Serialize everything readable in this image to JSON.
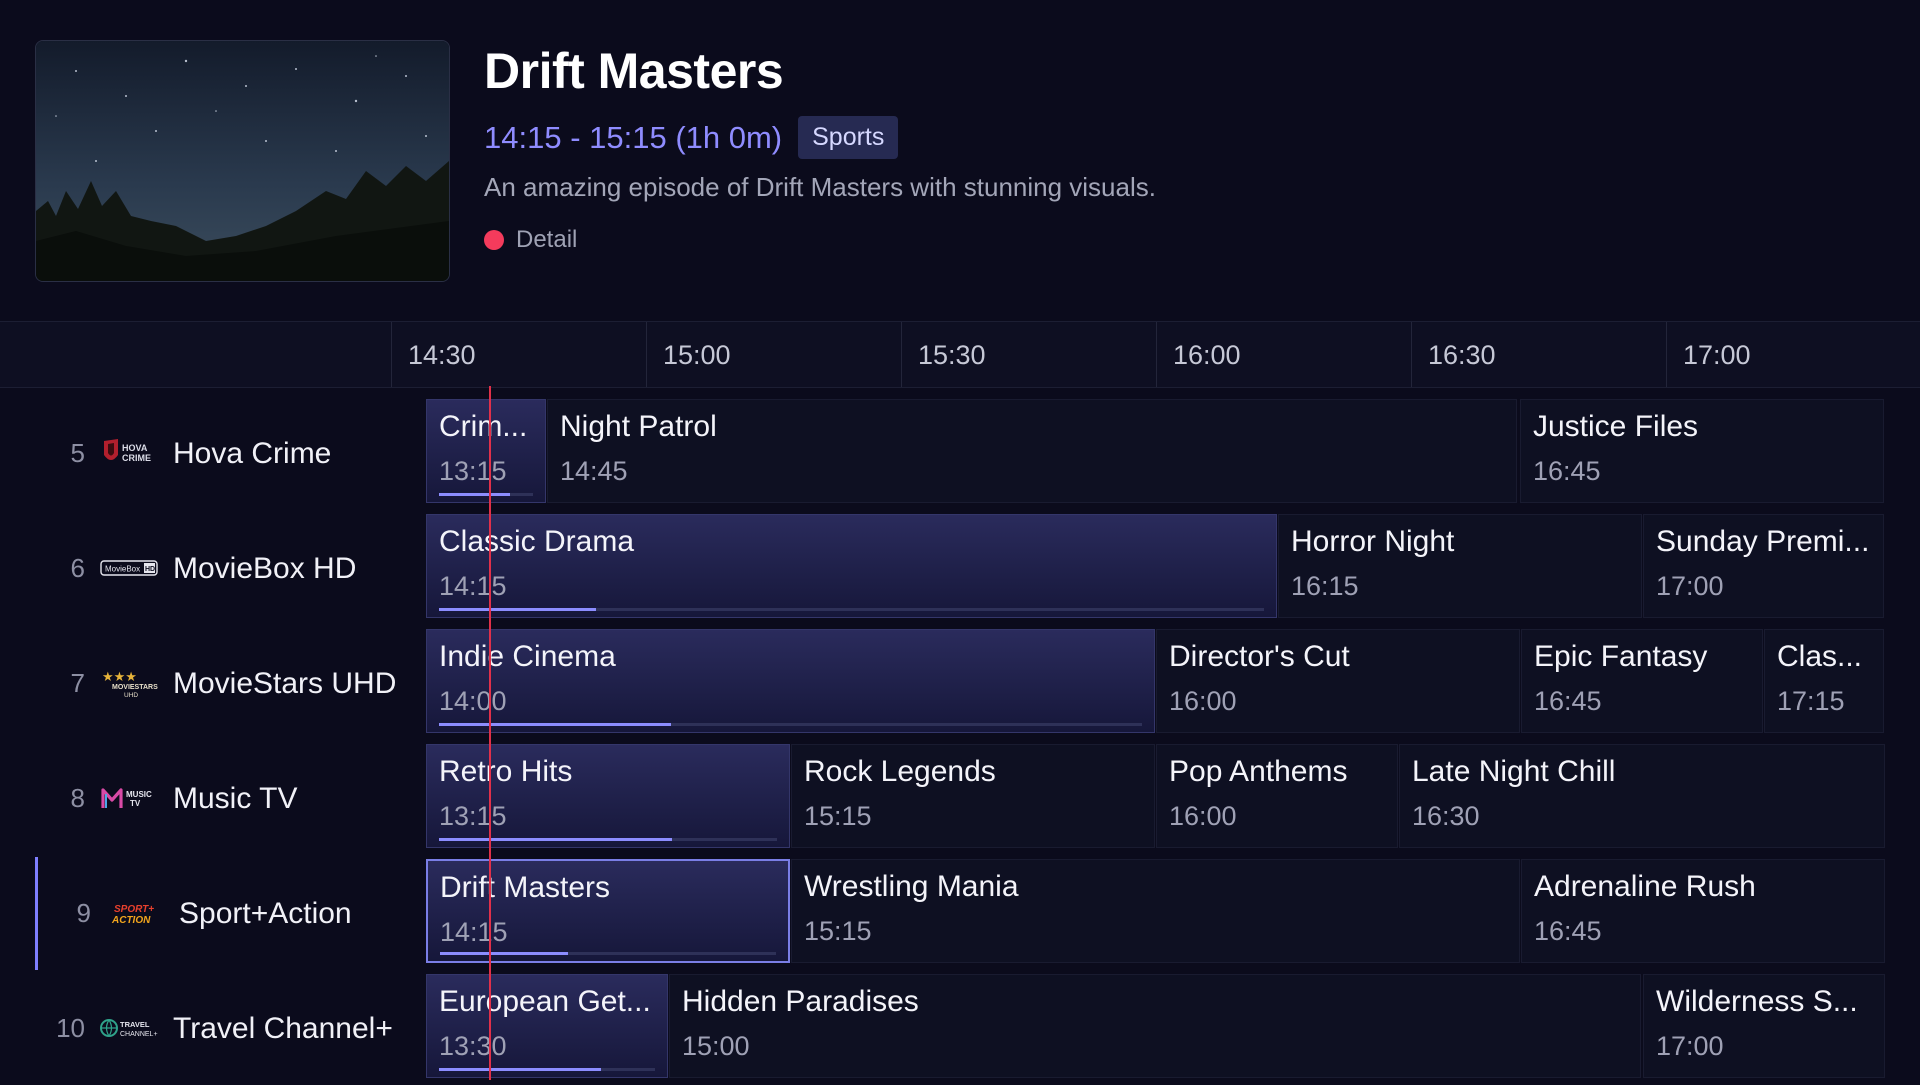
{
  "now_playing": {
    "title": "Drift Masters",
    "time_range": "14:15 - 15:15 (1h 0m)",
    "genre": "Sports",
    "description": "An amazing episode of Drift Masters with stunning visuals.",
    "detail_label": "Detail"
  },
  "timeline": {
    "slots": [
      "14:30",
      "15:00",
      "15:30",
      "16:00",
      "16:30",
      "17:00"
    ]
  },
  "colors": {
    "accent": "#8f8cff",
    "now_line": "#e0304a",
    "detail_dot": "#f43b5c",
    "background": "#0b0b1c"
  },
  "channels": [
    {
      "number": "5",
      "name": "Hova Crime",
      "logo": "hova-crime-logo",
      "programs": [
        {
          "title": "Crim...",
          "time": "13:15",
          "current": true,
          "progress": 0.75
        },
        {
          "title": "Night Patrol",
          "time": "14:45"
        },
        {
          "title": "Justice Files",
          "time": "16:45"
        }
      ]
    },
    {
      "number": "6",
      "name": "MovieBox HD",
      "logo": "moviebox-hd-logo",
      "programs": [
        {
          "title": "Classic Drama",
          "time": "14:15",
          "current": true,
          "progress": 0.19
        },
        {
          "title": "Horror Night",
          "time": "16:15"
        },
        {
          "title": "Sunday Premi...",
          "time": "17:00"
        }
      ]
    },
    {
      "number": "7",
      "name": "MovieStars UHD",
      "logo": "moviestars-uhd-logo",
      "programs": [
        {
          "title": "Indie Cinema",
          "time": "14:00",
          "current": true,
          "progress": 0.33
        },
        {
          "title": "Director's Cut",
          "time": "16:00"
        },
        {
          "title": "Epic Fantasy",
          "time": "16:45"
        },
        {
          "title": "Clas...",
          "time": "17:15"
        }
      ]
    },
    {
      "number": "8",
      "name": "Music TV",
      "logo": "music-tv-logo",
      "programs": [
        {
          "title": "Retro Hits",
          "time": "13:15",
          "current": true,
          "progress": 0.69
        },
        {
          "title": "Rock Legends",
          "time": "15:15"
        },
        {
          "title": "Pop Anthems",
          "time": "16:00"
        },
        {
          "title": "Late Night Chill",
          "time": "16:30"
        }
      ]
    },
    {
      "number": "9",
      "name": "Sport+Action",
      "logo": "sport-action-logo",
      "selected": true,
      "programs": [
        {
          "title": "Drift Masters",
          "time": "14:15",
          "current": true,
          "focused": true,
          "progress": 0.38
        },
        {
          "title": "Wrestling Mania",
          "time": "15:15"
        },
        {
          "title": "Adrenaline Rush",
          "time": "16:45"
        }
      ]
    },
    {
      "number": "10",
      "name": "Travel Channel+",
      "logo": "travel-channel-logo",
      "programs": [
        {
          "title": "European Get...",
          "time": "13:30",
          "current": true,
          "progress": 0.75
        },
        {
          "title": "Hidden Paradises",
          "time": "15:00"
        },
        {
          "title": "Wilderness S...",
          "time": "17:00"
        }
      ]
    }
  ]
}
